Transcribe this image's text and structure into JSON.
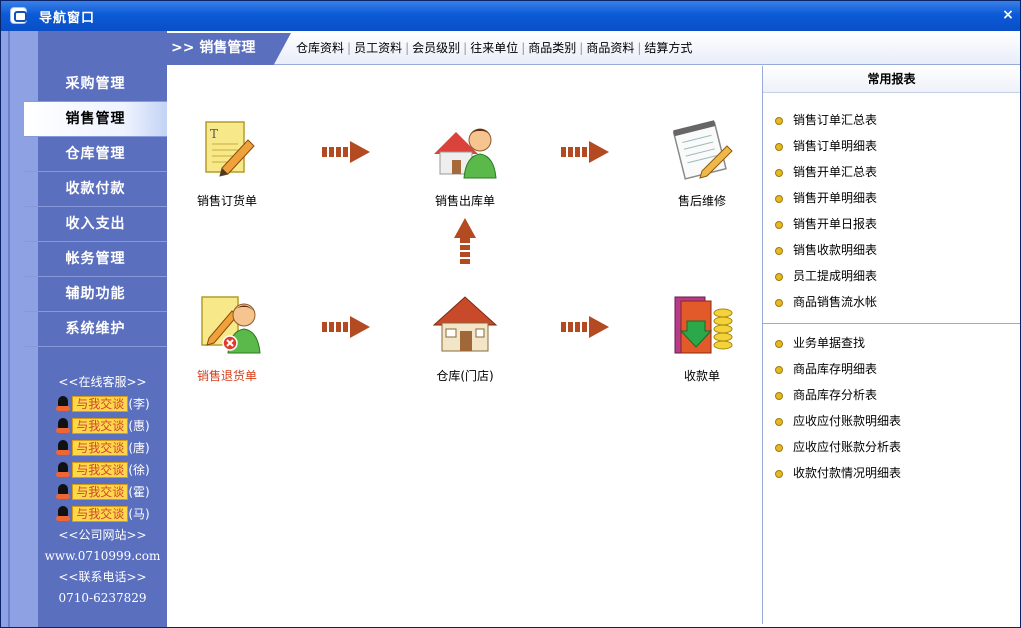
{
  "window": {
    "title": "导航窗口",
    "close_glyph": "×"
  },
  "sidebar": {
    "items": [
      {
        "label": "采购管理"
      },
      {
        "label": "销售管理"
      },
      {
        "label": "仓库管理"
      },
      {
        "label": "收款付款"
      },
      {
        "label": "收入支出"
      },
      {
        "label": "帐务管理"
      },
      {
        "label": "辅助功能"
      },
      {
        "label": "系统维护"
      }
    ],
    "active_index": 1,
    "service_heading": "<<在线客服>>",
    "chat_label": "与我交谈",
    "chat_people": [
      "(李)",
      "(惠)",
      "(唐)",
      "(徐)",
      "(霍)",
      "(马)"
    ],
    "website_heading": "<<公司网站>>",
    "website": "www.0710999.com",
    "phone_heading": "<<联系电话>>",
    "phone": "0710-6237829"
  },
  "topnav": {
    "section": ">> 销售管理",
    "links": [
      "仓库资料",
      "员工资料",
      "会员级别",
      "往来单位",
      "商品类别",
      "商品资料",
      "结算方式"
    ]
  },
  "flow": {
    "order": "销售订货单",
    "outbound": "销售出库单",
    "after_sales": "售后维修",
    "return": "销售退货单",
    "warehouse": "仓库(门店)",
    "receipt": "收款单"
  },
  "reports": {
    "title": "常用报表",
    "group1": [
      "销售订单汇总表",
      "销售订单明细表",
      "销售开单汇总表",
      "销售开单明细表",
      "销售开单日报表",
      "销售收款明细表",
      "员工提成明细表",
      "商品销售流水帐"
    ],
    "group2": [
      "业务单据查找",
      "商品库存明细表",
      "商品库存分析表",
      "应收应付账款明细表",
      "应收应付账款分析表",
      "收款付款情况明细表"
    ]
  },
  "colors": {
    "sidebar": "#5b6fbf",
    "titlebar": "#0b5ad6",
    "arrow": "#b34a22",
    "return_label": "#d43f1b"
  }
}
